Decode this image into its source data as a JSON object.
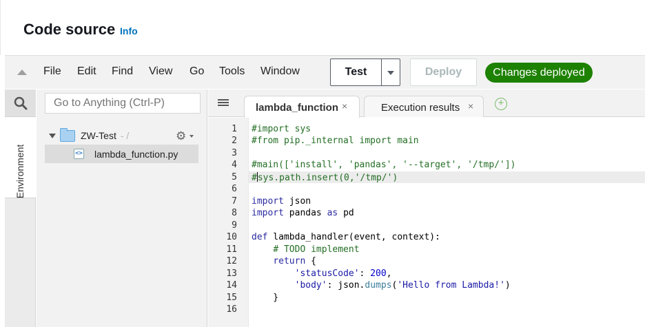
{
  "header": {
    "title": "Code source",
    "info_link": "Info"
  },
  "menubar": {
    "items": [
      "File",
      "Edit",
      "Find",
      "View",
      "Go",
      "Tools",
      "Window"
    ],
    "test_button": "Test",
    "deploy_button": "Deploy",
    "status_badge": "Changes deployed",
    "status_color": "#1d8102"
  },
  "sidebar": {
    "environment_label": "Environment",
    "search_icon": "search-icon"
  },
  "file_tree": {
    "goto_placeholder": "Go to Anything (Ctrl-P)",
    "root_folder": "ZW-Test",
    "root_suffix": "- /",
    "files": [
      "lambda_function.py"
    ]
  },
  "tabs": {
    "items": [
      {
        "label": "lambda_function",
        "active": true
      },
      {
        "label": "Execution results",
        "active": false
      }
    ],
    "close_glyph": "×",
    "add_glyph": "+"
  },
  "editor": {
    "line_numbers": [
      "1",
      "2",
      "3",
      "4",
      "5",
      "6",
      "7",
      "8",
      "9",
      "10",
      "11",
      "12",
      "13",
      "14",
      "15",
      "16"
    ],
    "active_line": 5,
    "lines": [
      "#import sys",
      "#from pip._internal import main",
      "",
      "#main(['install', 'pandas', '--target', '/tmp/'])",
      "#sys.path.insert(0,'/tmp/')",
      "",
      "import json",
      "import pandas as pd",
      "",
      "def lambda_handler(event, context):",
      "    # TODO implement",
      "    return {",
      "        'statusCode': 200,",
      "        'body': json.dumps('Hello from Lambda!')",
      "    }",
      ""
    ]
  }
}
